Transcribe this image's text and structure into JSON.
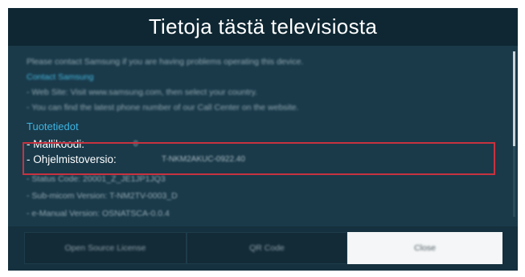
{
  "dialog": {
    "title": "Tietoja tästä televisiosta"
  },
  "content": {
    "contact_note": "Please contact Samsung if you are having problems operating this device.",
    "contact_heading": "Contact Samsung",
    "web_site_line": "- Web Site: Visit www.samsung.com, then select your country.",
    "phone_line": "- You can find the latest phone number of our Call Center on the website.",
    "product_info_heading": "Tuotetiedot",
    "model_code_label": "- Mallikoodi:",
    "model_code_value": "0",
    "software_version_label": "- Ohjelmistoversio:",
    "software_version_value": "T-NKM2AKUC-0922.40",
    "status_code_line": "- Status Code: 20001_Z_JE1JP1JQ3",
    "sub_micom_line": "- Sub-micom Version: T-NM2TV-0003_D",
    "emanual_line": "- e-Manual Version: OSNATSCA-0.0.4"
  },
  "buttons": {
    "open_source": "Open Source License",
    "qr_code": "QR Code",
    "close": "Close"
  },
  "colors": {
    "dialog_background": "#15303e",
    "title_background": "#0e2733",
    "accent": "#3db3e0",
    "highlight_border": "#c8323f"
  }
}
